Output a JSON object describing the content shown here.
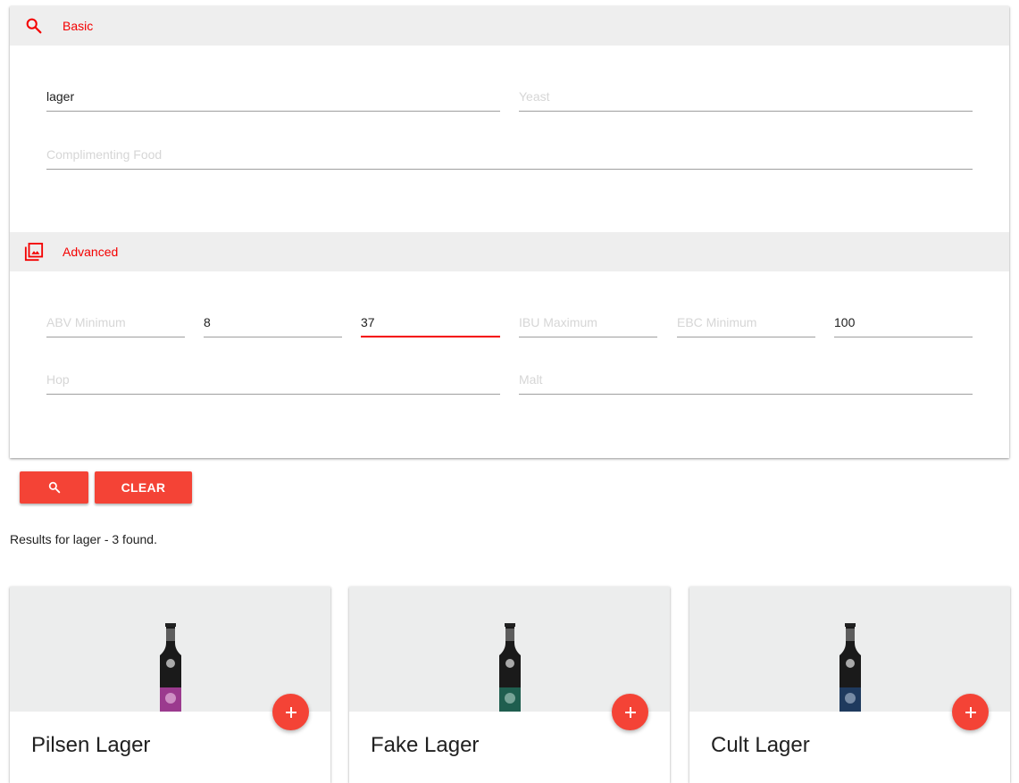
{
  "basic": {
    "header_label": "Basic",
    "name_value": "lager",
    "yeast_placeholder": "Yeast",
    "food_placeholder": "Complimenting Food"
  },
  "advanced": {
    "header_label": "Advanced",
    "abv_min_placeholder": "ABV Minimum",
    "abv_max_value": "8",
    "ibu_min_value": "37",
    "ibu_max_placeholder": "IBU Maximum",
    "ebc_min_placeholder": "EBC Minimum",
    "ebc_max_value": "100",
    "hop_placeholder": "Hop",
    "malt_placeholder": "Malt"
  },
  "actions": {
    "clear_label": "CLEAR",
    "search_icon": "search-icon"
  },
  "results": {
    "summary": "Results for lager - 3 found.",
    "cards": [
      {
        "title": "Pilsen Lager",
        "label_color": "#9b3a8e"
      },
      {
        "title": "Fake Lager",
        "label_color": "#1f5e4f"
      },
      {
        "title": "Cult Lager",
        "label_color": "#1f3a5e"
      }
    ]
  },
  "colors": {
    "accent": "#f40000",
    "button": "#f44336",
    "header_bg": "#eeeeee"
  }
}
